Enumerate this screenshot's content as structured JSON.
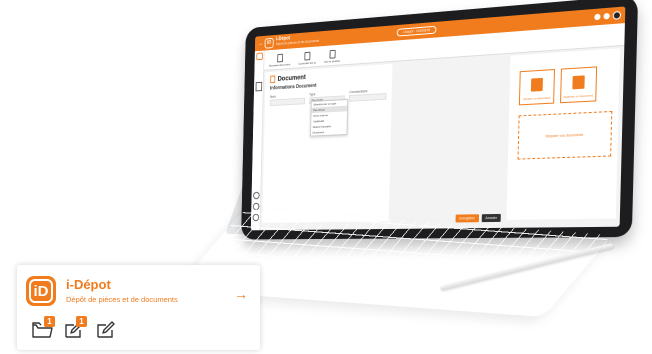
{
  "app": {
    "title": "i-Dépot",
    "subtitle": "Dépôt de pièces et de documents",
    "logo_text": "iD",
    "accent_color": "#f07c1d",
    "window_pill": "i-Dépôt - 12345678",
    "topbar_subtitle": "Dépôt de pièces et de documents"
  },
  "toolbar": {
    "items": [
      {
        "label": "Nouveau document"
      },
      {
        "label": "Consulter les pj"
      },
      {
        "label": "Voir le dossier"
      }
    ]
  },
  "document": {
    "heading": "Document",
    "section_title": "Informations Document",
    "fields": [
      {
        "label": "Nom",
        "value": ""
      },
      {
        "label": "Type",
        "value": "Pas choisi"
      },
      {
        "label": "Commentaire",
        "value": ""
      }
    ],
    "type_options": [
      "Sélectionner un type",
      "Pas choisi",
      "Choix interne",
      "Justificatif",
      "Relevé bancaire",
      "Document"
    ],
    "selected_option_index": 1
  },
  "actions": {
    "download_label": "Joindre un document",
    "scan_label": "Scanner un document",
    "drop_zone_label": "Déposer vos documents"
  },
  "buttons": {
    "primary": "Enregistrer",
    "secondary": "Annuler"
  },
  "card": {
    "title": "i-Dépot",
    "subtitle": "Dépôt de pièces et de documents",
    "arrow": "→",
    "icons": [
      {
        "name": "folder-icon",
        "badge": "1"
      },
      {
        "name": "edit-icon",
        "badge": "1"
      },
      {
        "name": "edit-alt-icon",
        "badge": ""
      }
    ]
  }
}
